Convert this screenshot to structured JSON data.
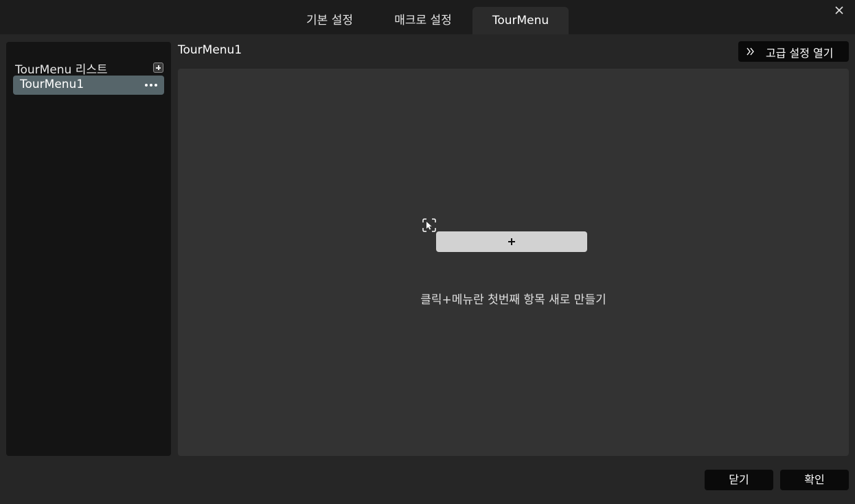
{
  "tabs": [
    {
      "label": "기본 설정",
      "active": false
    },
    {
      "label": "매크로 설정",
      "active": false
    },
    {
      "label": "TourMenu",
      "active": true
    }
  ],
  "close_icon": "close-icon",
  "sidebar": {
    "title": "TourMenu 리스트",
    "add_icon": "plus-icon",
    "items": [
      {
        "label": "TourMenu1",
        "selected": true,
        "more_icon": "more-horizontal-icon"
      }
    ]
  },
  "main": {
    "title": "TourMenu1",
    "advanced_button": {
      "label": "고급 설정 열기",
      "icon": "double-chevron-right-icon"
    },
    "canvas": {
      "cursor_icon": "cursor-select-icon",
      "add_icon": "plus-icon",
      "hint": "클릭+메뉴란 첫번째 항목 새로 만들기"
    }
  },
  "footer": {
    "close_label": "닫기",
    "confirm_label": "확인"
  },
  "colors": {
    "background": "#262626",
    "sidebar": "#141414",
    "canvas": "#333333",
    "selected_item": "#56656a",
    "button": "#0a0a0a"
  }
}
